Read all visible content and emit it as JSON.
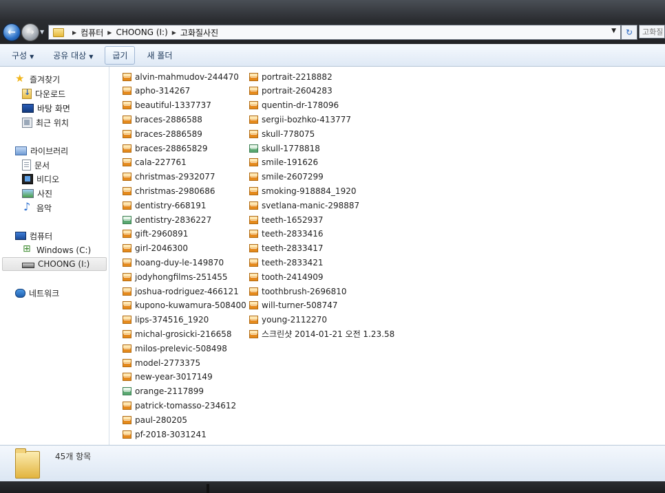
{
  "address": {
    "crumbs": [
      "컴퓨터",
      "CHOONG (I:)",
      "고화질사진"
    ],
    "search_placeholder": "고화질"
  },
  "toolbar": {
    "organize": "구성",
    "share": "공유 대상",
    "burn": "굽기",
    "new_folder": "새 폴더"
  },
  "nav": {
    "favorites": "즐겨찾기",
    "downloads": "다운로드",
    "desktop": "바탕 화면",
    "recent": "최근 위치",
    "libraries": "라이브러리",
    "documents": "문서",
    "video": "비디오",
    "pictures": "사진",
    "music": "음악",
    "computer": "컴퓨터",
    "windows_drive": "Windows (C:)",
    "usb_drive": "CHOONG (I:)",
    "network": "네트워크"
  },
  "files": {
    "col1": [
      {
        "name": "alvin-mahmudov-244470",
        "type": "jpg"
      },
      {
        "name": "apho-314267",
        "type": "jpg"
      },
      {
        "name": "beautiful-1337737",
        "type": "jpg"
      },
      {
        "name": "braces-2886588",
        "type": "jpg"
      },
      {
        "name": "braces-2886589",
        "type": "jpg"
      },
      {
        "name": "braces-28865829",
        "type": "jpg"
      },
      {
        "name": "cala-227761",
        "type": "jpg"
      },
      {
        "name": "christmas-2932077",
        "type": "jpg"
      },
      {
        "name": "christmas-2980686",
        "type": "jpg"
      },
      {
        "name": "dentistry-668191",
        "type": "jpg"
      },
      {
        "name": "dentistry-2836227",
        "type": "png"
      },
      {
        "name": "gift-2960891",
        "type": "jpg"
      },
      {
        "name": "girl-2046300",
        "type": "jpg"
      },
      {
        "name": "hoang-duy-le-149870",
        "type": "jpg"
      },
      {
        "name": "jodyhongfilms-251455",
        "type": "jpg"
      },
      {
        "name": "joshua-rodriguez-466121",
        "type": "jpg"
      },
      {
        "name": "kupono-kuwamura-508400",
        "type": "jpg"
      },
      {
        "name": "lips-374516_1920",
        "type": "jpg"
      },
      {
        "name": "michal-grosicki-216658",
        "type": "jpg"
      },
      {
        "name": "milos-prelevic-508498",
        "type": "jpg"
      },
      {
        "name": "model-2773375",
        "type": "jpg"
      },
      {
        "name": "new-year-3017149",
        "type": "jpg"
      },
      {
        "name": "orange-2117899",
        "type": "png"
      },
      {
        "name": "patrick-tomasso-234612",
        "type": "jpg"
      },
      {
        "name": "paul-280205",
        "type": "jpg"
      },
      {
        "name": "pf-2018-3031241",
        "type": "jpg"
      }
    ],
    "col2": [
      {
        "name": "portrait-2218882",
        "type": "jpg"
      },
      {
        "name": "portrait-2604283",
        "type": "jpg"
      },
      {
        "name": "quentin-dr-178096",
        "type": "jpg"
      },
      {
        "name": "sergii-bozhko-413777",
        "type": "jpg"
      },
      {
        "name": "skull-778075",
        "type": "jpg"
      },
      {
        "name": "skull-1778818",
        "type": "png"
      },
      {
        "name": "smile-191626",
        "type": "jpg"
      },
      {
        "name": "smile-2607299",
        "type": "jpg"
      },
      {
        "name": "smoking-918884_1920",
        "type": "jpg"
      },
      {
        "name": "svetlana-manic-298887",
        "type": "jpg"
      },
      {
        "name": "teeth-1652937",
        "type": "jpg"
      },
      {
        "name": "teeth-2833416",
        "type": "jpg"
      },
      {
        "name": "teeth-2833417",
        "type": "jpg"
      },
      {
        "name": "teeth-2833421",
        "type": "jpg"
      },
      {
        "name": "tooth-2414909",
        "type": "jpg"
      },
      {
        "name": "toothbrush-2696810",
        "type": "jpg"
      },
      {
        "name": "will-turner-508747",
        "type": "jpg"
      },
      {
        "name": "young-2112270",
        "type": "jpg"
      },
      {
        "name": "스크린샷 2014-01-21 오전 1.23.58",
        "type": "jpg"
      }
    ]
  },
  "details": {
    "count": "45개 항목"
  }
}
